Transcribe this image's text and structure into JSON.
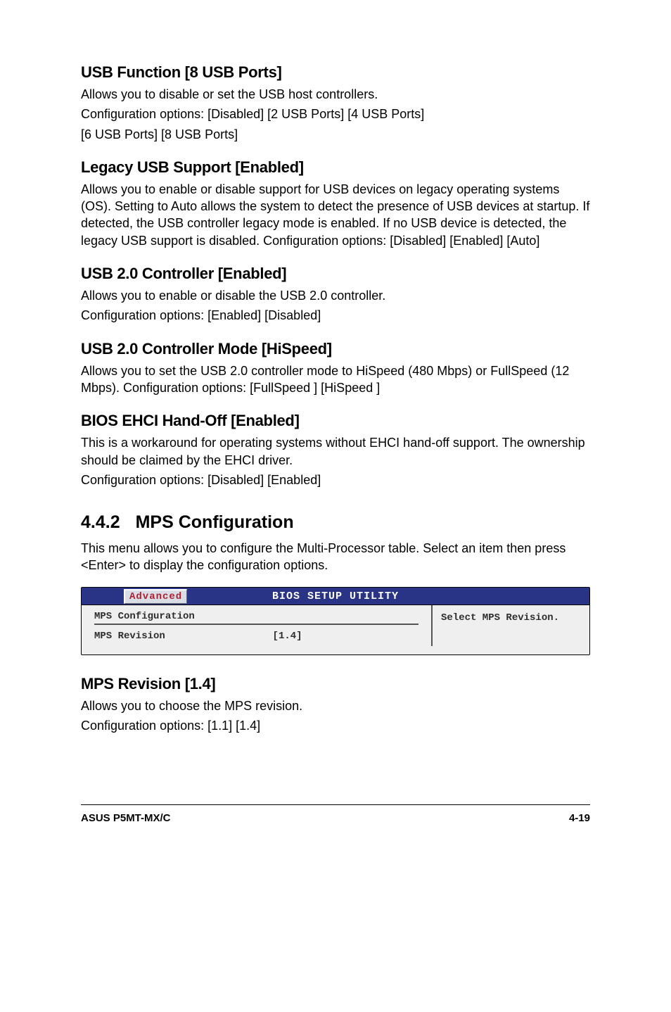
{
  "s1": {
    "heading": "USB Function [8 USB Ports]",
    "p1": "Allows you to disable or set the USB host controllers.",
    "p2": "Configuration options: [Disabled] [2 USB Ports] [4 USB Ports]",
    "p3": "[6 USB Ports] [8 USB Ports]"
  },
  "s2": {
    "heading": "Legacy USB Support [Enabled]",
    "p1": "Allows you to enable or disable support for USB devices on legacy operating systems (OS). Setting to Auto allows the system to detect the presence of USB devices at startup. If detected, the USB controller legacy mode is enabled. If no USB device is detected, the legacy USB support is disabled. Configuration options: [Disabled] [Enabled] [Auto]"
  },
  "s3": {
    "heading": "USB 2.0 Controller [Enabled]",
    "p1": "Allows you to enable or disable the USB 2.0 controller.",
    "p2": "Configuration options: [Enabled] [Disabled]"
  },
  "s4": {
    "heading": "USB 2.0 Controller Mode [HiSpeed]",
    "p1": "Allows you to set the USB 2.0 controller mode to HiSpeed (480 Mbps) or FullSpeed (12 Mbps). Configuration options: [FullSpeed ] [HiSpeed ]"
  },
  "s5": {
    "heading": "BIOS EHCI Hand-Off [Enabled]",
    "p1": "This is a workaround for operating systems without EHCI hand-off support. The ownership should be claimed by the EHCI driver.",
    "p2": "Configuration options: [Disabled] [Enabled]"
  },
  "mps": {
    "number": "4.4.2",
    "title": "MPS Configuration",
    "intro": "This menu allows you to configure the Multi-Processor table. Select an item then press <Enter> to display the configuration options."
  },
  "bios": {
    "tab": "Advanced",
    "header": "BIOS SETUP UTILITY",
    "cfg_title": "MPS Configuration",
    "row_label": "MPS Revision",
    "row_value": "[1.4]",
    "help": "Select MPS Revision."
  },
  "s6": {
    "heading": "MPS Revision [1.4]",
    "p1": "Allows you to choose the MPS revision.",
    "p2": "Configuration options: [1.1] [1.4]"
  },
  "footer": {
    "left": "ASUS P5MT-MX/C",
    "right": "4-19"
  }
}
